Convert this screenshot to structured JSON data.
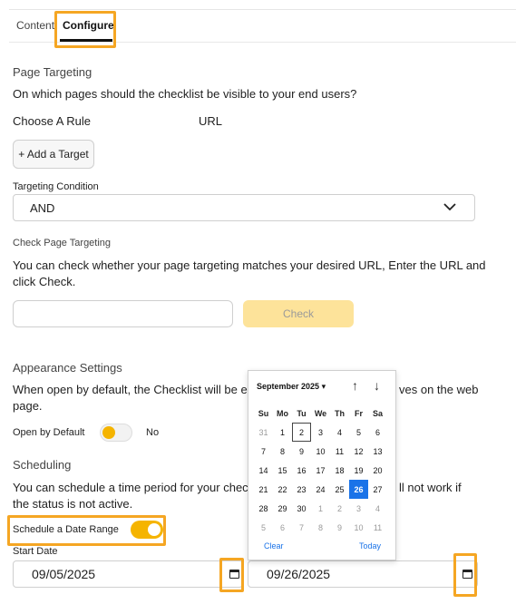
{
  "tabs": [
    {
      "label": "Content"
    },
    {
      "label": "Configure"
    }
  ],
  "page_targeting": {
    "title": "Page Targeting",
    "question": "On which pages should the checklist be visible to your end users?",
    "rule_label": "Choose A Rule",
    "rule_value": "URL",
    "add_target_label": "+ Add a Target",
    "condition_label": "Targeting Condition",
    "condition_value": "AND"
  },
  "check_targeting": {
    "title": "Check Page Targeting",
    "desc_line1": "You can check whether your page targeting matches your desired URL, Enter the URL and",
    "desc_line2": "click Check.",
    "url_value": "",
    "check_label": "Check"
  },
  "appearance": {
    "title": "Appearance Settings",
    "desc_line1_left": "When open by default, the Checklist will be ex",
    "desc_line1_right": "ves on the web",
    "desc_line2": "page.",
    "open_default_label": "Open by Default",
    "open_default_value": "No"
  },
  "scheduling": {
    "title": "Scheduling",
    "desc_line1_left": "You can schedule a time period for your check",
    "desc_line1_right": "ll not work if",
    "desc_line2": "the status is not active.",
    "date_range_label": "Schedule a Date Range",
    "date_range_on": true,
    "start_label": "Start Date",
    "start_value": "09/05/2025",
    "end_value": "09/26/2025"
  },
  "datepicker": {
    "month_label": "September 2025",
    "weekdays": [
      "Su",
      "Mo",
      "Tu",
      "We",
      "Th",
      "Fr",
      "Sa"
    ],
    "days": [
      {
        "d": "31",
        "m": true
      },
      {
        "d": "1"
      },
      {
        "d": "2",
        "today": true
      },
      {
        "d": "3"
      },
      {
        "d": "4"
      },
      {
        "d": "5"
      },
      {
        "d": "6"
      },
      {
        "d": "7"
      },
      {
        "d": "8"
      },
      {
        "d": "9"
      },
      {
        "d": "10"
      },
      {
        "d": "11"
      },
      {
        "d": "12"
      },
      {
        "d": "13"
      },
      {
        "d": "14"
      },
      {
        "d": "15"
      },
      {
        "d": "16"
      },
      {
        "d": "17"
      },
      {
        "d": "18"
      },
      {
        "d": "19"
      },
      {
        "d": "20"
      },
      {
        "d": "21"
      },
      {
        "d": "22"
      },
      {
        "d": "23"
      },
      {
        "d": "24"
      },
      {
        "d": "25"
      },
      {
        "d": "26",
        "sel": true
      },
      {
        "d": "27"
      },
      {
        "d": "28"
      },
      {
        "d": "29"
      },
      {
        "d": "30"
      },
      {
        "d": "1",
        "m": true
      },
      {
        "d": "2",
        "m": true
      },
      {
        "d": "3",
        "m": true
      },
      {
        "d": "4",
        "m": true
      },
      {
        "d": "5",
        "m": true
      },
      {
        "d": "6",
        "m": true
      },
      {
        "d": "7",
        "m": true
      },
      {
        "d": "8",
        "m": true
      },
      {
        "d": "9",
        "m": true
      },
      {
        "d": "10",
        "m": true
      },
      {
        "d": "11",
        "m": true
      }
    ],
    "clear_label": "Clear",
    "today_label": "Today"
  },
  "colors": {
    "accent": "#f5a623",
    "toggle_on": "#f5b400",
    "selected_day": "#1a73e8"
  }
}
